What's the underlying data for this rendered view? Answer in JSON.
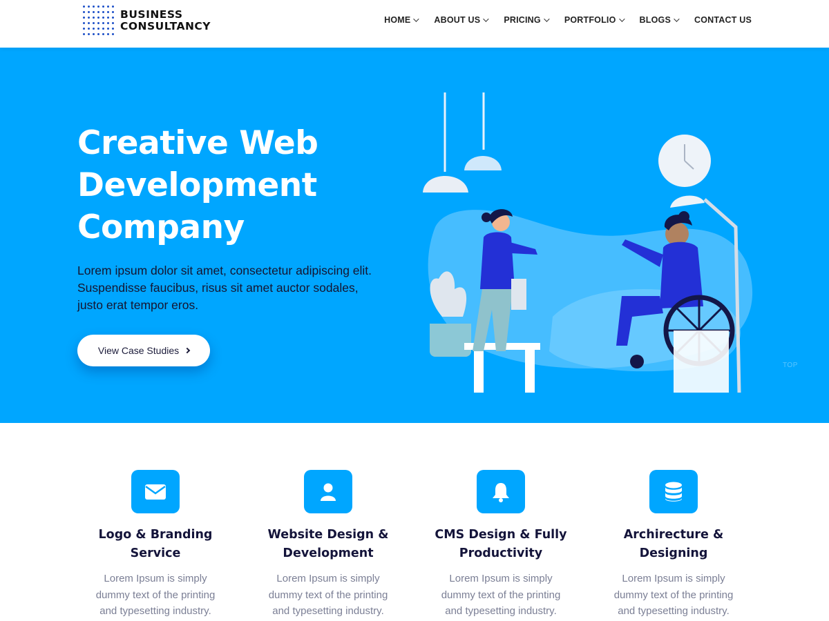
{
  "brand": {
    "line1": "BUSINESS",
    "line2": "CONSULTANCY"
  },
  "nav": [
    {
      "label": "HOME",
      "dropdown": true
    },
    {
      "label": "ABOUT US",
      "dropdown": true
    },
    {
      "label": "PRICING",
      "dropdown": true
    },
    {
      "label": "PORTFOLIO",
      "dropdown": true
    },
    {
      "label": "BLOGS",
      "dropdown": true
    },
    {
      "label": "CONTACT US",
      "dropdown": false
    }
  ],
  "hero": {
    "title_lines": [
      "Creative Web",
      "Development",
      "Company"
    ],
    "description_lines": [
      "Lorem ipsum dolor sit amet, consectetur adipiscing elit.",
      "Suspendisse faucibus, risus sit amet auctor sodales,",
      "justo erat tempor eros."
    ],
    "button_label": "View Case Studies",
    "top_link": "TOP"
  },
  "services": [
    {
      "icon": "envelope-icon",
      "title_lines": [
        "Logo & Branding",
        "Service"
      ],
      "desc_lines": [
        "Lorem Ipsum is simply",
        "dummy text of the printing",
        "and typesetting industry."
      ]
    },
    {
      "icon": "user-icon",
      "title_lines": [
        "Website Design &",
        "Development"
      ],
      "desc_lines": [
        "Lorem Ipsum is simply",
        "dummy text of the printing",
        "and typesetting industry."
      ]
    },
    {
      "icon": "bell-icon",
      "title_lines": [
        "CMS Design & Fully",
        "Productivity"
      ],
      "desc_lines": [
        "Lorem Ipsum is simply",
        "dummy text of the printing",
        "and typesetting industry."
      ]
    },
    {
      "icon": "database-icon",
      "title_lines": [
        "Archirecture &",
        "Designing"
      ],
      "desc_lines": [
        "Lorem Ipsum is simply",
        "dummy text of the printing",
        "and typesetting industry."
      ]
    }
  ],
  "colors": {
    "primary": "#00a6ff",
    "heading": "#14143a",
    "body_text": "#7b7f95",
    "logo_dots": "#1c4fc7"
  }
}
